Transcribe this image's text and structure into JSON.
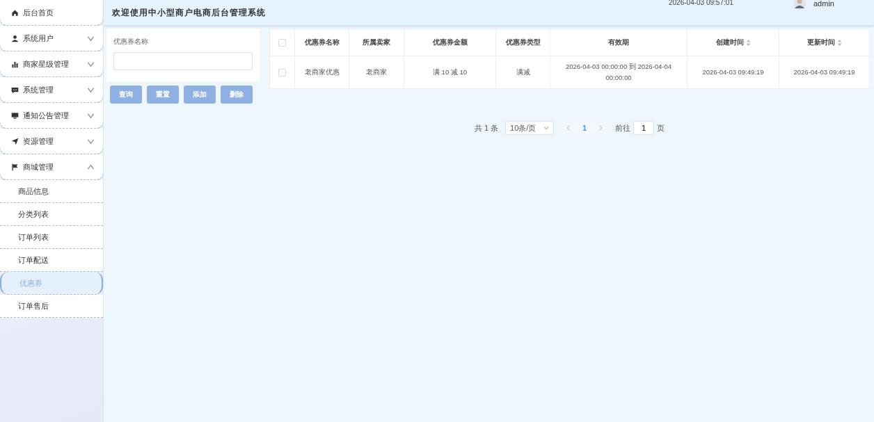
{
  "sidebar": {
    "items": [
      {
        "label": "后台首页"
      },
      {
        "label": "系统用户",
        "expanded": false
      },
      {
        "label": "商家星级管理",
        "expanded": false
      },
      {
        "label": "系统管理",
        "expanded": false
      },
      {
        "label": "通知公告管理",
        "expanded": false
      },
      {
        "label": "资源管理",
        "expanded": false
      },
      {
        "label": "商城管理",
        "expanded": true,
        "children": [
          {
            "label": "商品信息",
            "selected": false
          },
          {
            "label": "分类列表",
            "selected": false
          },
          {
            "label": "订单列表",
            "selected": false
          },
          {
            "label": "订单配送",
            "selected": false
          },
          {
            "label": "优惠券",
            "selected": true
          },
          {
            "label": "订单售后",
            "selected": false
          }
        ]
      }
    ]
  },
  "header": {
    "title": "欢迎使用中小型商户电商后台管理系统",
    "datetime": "2026-04-03 09:57:01",
    "user": "admin"
  },
  "filter": {
    "label": "优惠券名称",
    "buttons": [
      "查询",
      "重置",
      "添加",
      "删除"
    ]
  },
  "table": {
    "all_checked": false,
    "columns": [
      {
        "label": "优惠券名称",
        "sortable": false
      },
      {
        "label": "所属卖家",
        "sortable": false
      },
      {
        "label": "优惠券金额",
        "sortable": false
      },
      {
        "label": "优惠券类型",
        "sortable": false
      },
      {
        "label": "有效期",
        "sortable": false
      },
      {
        "label": "创建时间",
        "sortable": true
      },
      {
        "label": "更新时间",
        "sortable": true
      }
    ],
    "rows": [
      {
        "checked": false,
        "cells": [
          "老商家优惠",
          "老商家",
          "满 10 减 10",
          "满减",
          "2026-04-03 00:00:00 到 2026-04-04 00:00:00",
          "2026-04-03 09:49:19",
          "2026-04-03 09:49:19"
        ]
      }
    ]
  },
  "pagination": {
    "total": "共 1 条",
    "page_size": "10条/页",
    "pages": [
      {
        "label": "1",
        "selected": true
      }
    ],
    "goto_label": "前往",
    "goto_value": "1",
    "goto_suffix": "页"
  }
}
